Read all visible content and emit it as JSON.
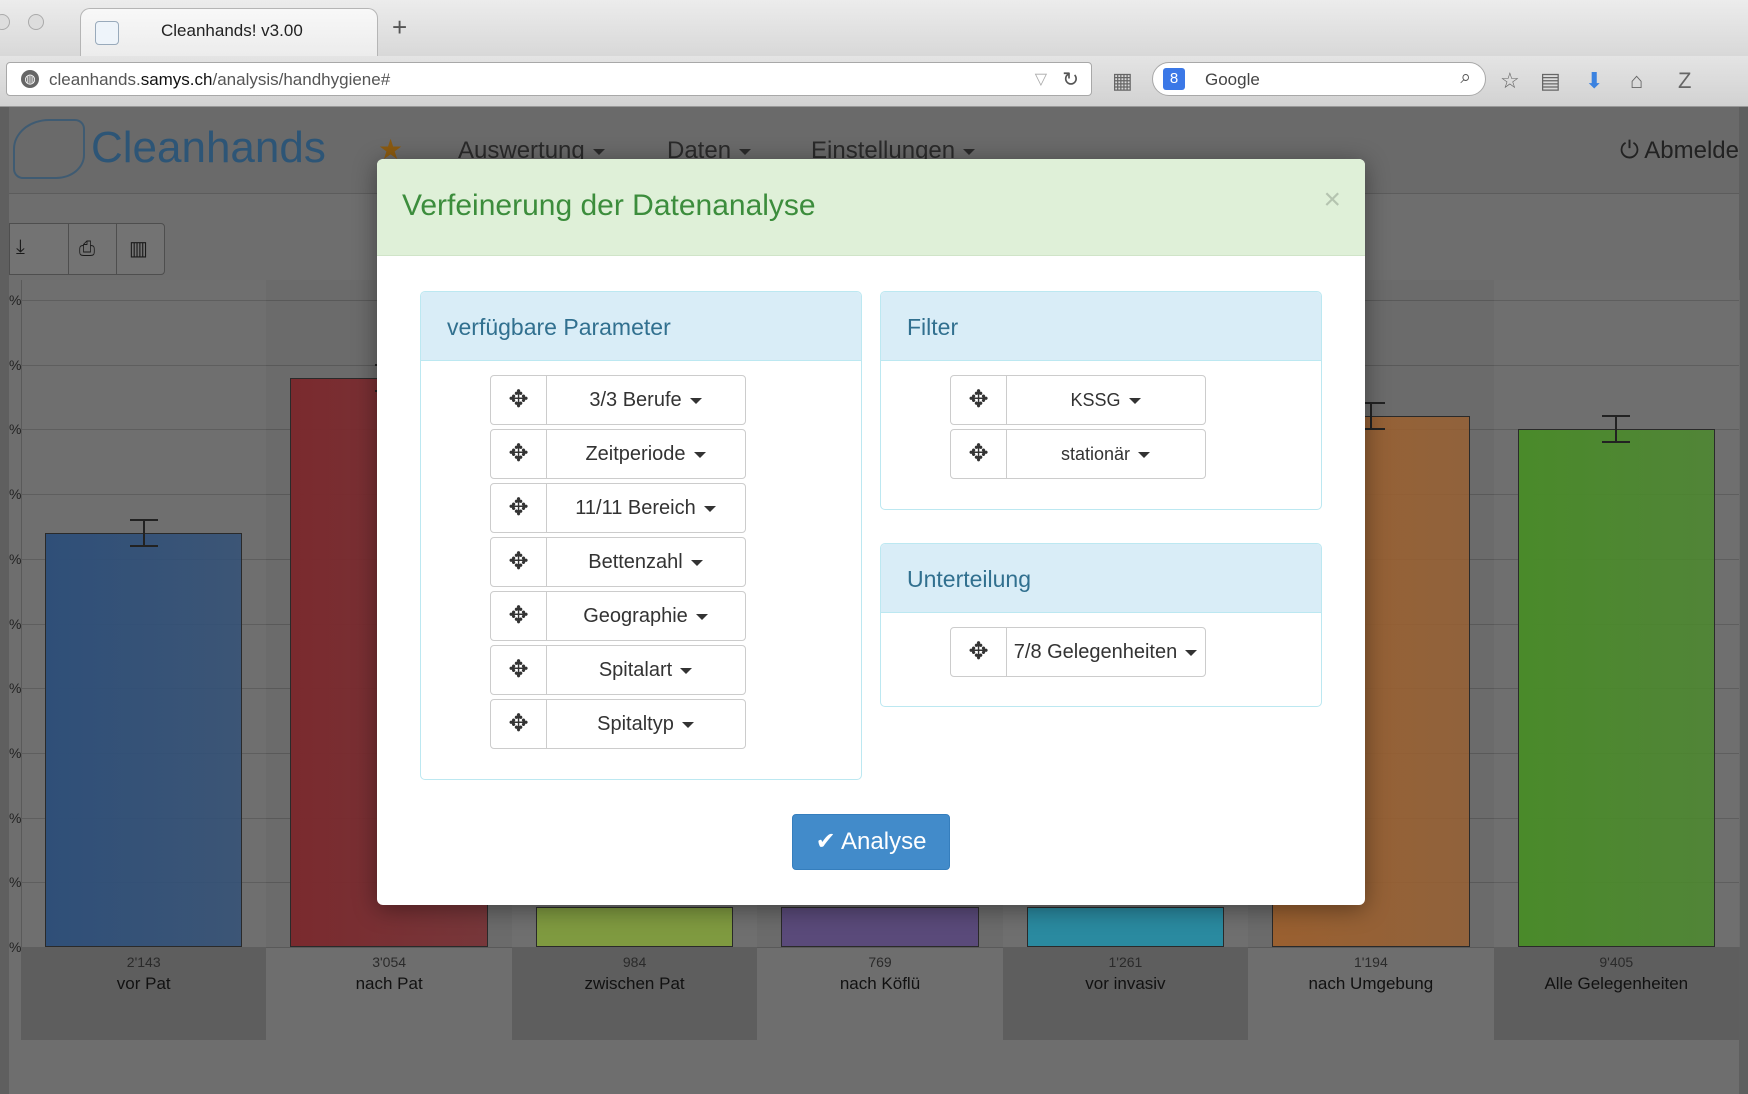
{
  "browser": {
    "tab_title": "Cleanhands! v3.00",
    "new_tab": "+",
    "url_host_prefix": "cleanhands.",
    "url_host_domain": "samys.ch",
    "url_path": "/analysis/handhygiene#",
    "search_placeholder": "Google",
    "search_engine_letter": "8"
  },
  "nav": {
    "brand": "Cleanhands",
    "items": [
      "Auswertung",
      "Daten",
      "Einstellungen"
    ],
    "logout": "Abmelde"
  },
  "chart_data": {
    "type": "bar",
    "categories": [
      "vor Pat",
      "nach Pat",
      "zwischen Pat",
      "nach Köflü",
      "vor invasiv",
      "nach Umgebung",
      "Alle Gelegenheiten"
    ],
    "counts": [
      "2'143",
      "3'054",
      "984",
      "769",
      "1'261",
      "1'194",
      "9'405"
    ],
    "values": [
      64,
      88,
      null,
      null,
      null,
      82,
      80
    ],
    "colors": [
      "#2f4f78",
      "#7a2a2e",
      "#7f9a40",
      "#5a4a7a",
      "#2a8aa0",
      "#9a6030",
      "#4a8a2a"
    ],
    "ylim": [
      0,
      100
    ],
    "grid": true
  },
  "modal": {
    "title": "Verfeinerung der Datenanalyse",
    "close": "×",
    "available_title": "verfügbare Parameter",
    "available": [
      "3/3 Berufe",
      "Zeitperiode",
      "11/11 Bereich",
      "Bettenzahl",
      "Geographie",
      "Spitalart",
      "Spitaltyp"
    ],
    "filter_title": "Filter",
    "filters": [
      "KSSG",
      "stationär"
    ],
    "grouping_title": "Unterteilung",
    "grouping": [
      "7/8 Gelegenheiten"
    ],
    "analyse_label": "Analyse"
  }
}
